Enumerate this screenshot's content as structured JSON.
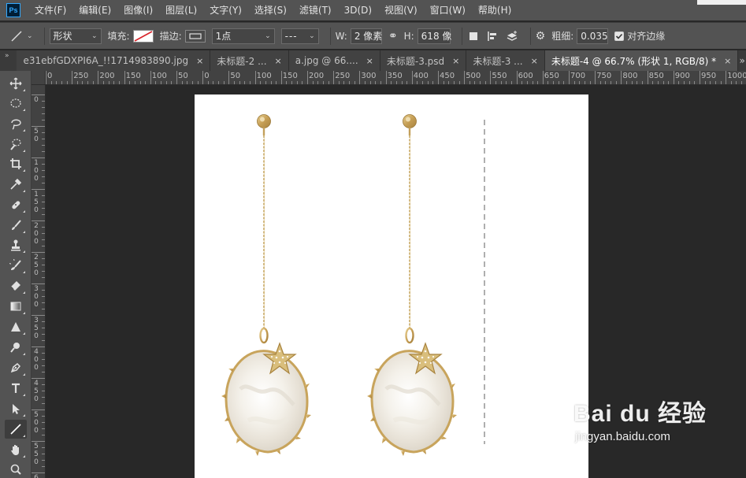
{
  "app": {
    "logo_text": "Ps"
  },
  "menu": {
    "items": [
      "文件(F)",
      "编辑(E)",
      "图像(I)",
      "图层(L)",
      "文字(Y)",
      "选择(S)",
      "滤镜(T)",
      "3D(D)",
      "视图(V)",
      "窗口(W)",
      "帮助(H)"
    ]
  },
  "options": {
    "mode": "形状",
    "fill_label": "填充:",
    "stroke_label": "描边:",
    "stroke_width": "1点",
    "stroke_style": "---",
    "w_label": "W:",
    "w_value": "2 像素",
    "h_label": "H:",
    "h_value": "618 像",
    "weight_label": "粗细:",
    "weight_value": "0.035 ",
    "align_edges_label": "对齐边缘",
    "align_edges_checked": true
  },
  "tabs": [
    {
      "label": "e31ebfGDXPI6A_!!1714983890.jpg",
      "active": false
    },
    {
      "label": "未标题-2 ...",
      "active": false
    },
    {
      "label": "a.jpg @ 66....",
      "active": false
    },
    {
      "label": "未标题-3.psd",
      "active": false
    },
    {
      "label": "未标题-3 ...",
      "active": false
    },
    {
      "label": "未标题-4 @ 66.7% (形状 1, RGB/8) *",
      "active": true
    }
  ],
  "tab_close_glyph": "×",
  "tab_overflow_glyph": "»",
  "tab_collapse_glyph": "»",
  "ruler": {
    "h_labels": [
      "0",
      "250",
      "200",
      "150",
      "100",
      "50",
      "0",
      "50",
      "100",
      "150",
      "200",
      "250",
      "300",
      "350",
      "400",
      "450",
      "500",
      "550",
      "600",
      "650",
      "700",
      "750",
      "800",
      "850",
      "900",
      "950",
      "1000"
    ],
    "v_labels": [
      "0",
      "50",
      "100",
      "150",
      "200",
      "250",
      "300",
      "350",
      "400",
      "450",
      "500",
      "550",
      "600"
    ]
  },
  "tools": [
    "move-icon",
    "marquee-icon",
    "lasso-icon",
    "quick-select-icon",
    "crop-icon",
    "eyedropper-icon",
    "healing-icon",
    "brush-icon",
    "stamp-icon",
    "history-brush-icon",
    "eraser-icon",
    "gradient-icon",
    "sharpen-icon",
    "dodge-icon",
    "pen-icon",
    "type-icon",
    "path-select-icon",
    "line-icon",
    "hand-icon",
    "zoom-icon"
  ],
  "active_tool": "line-icon",
  "colors": {
    "gold": "#c9a55a",
    "shell": "#f3efe8",
    "guide": "#7a7a7a"
  },
  "watermark": {
    "logo": "Bai du 经验",
    "url": "jingyan.baidu.com"
  }
}
